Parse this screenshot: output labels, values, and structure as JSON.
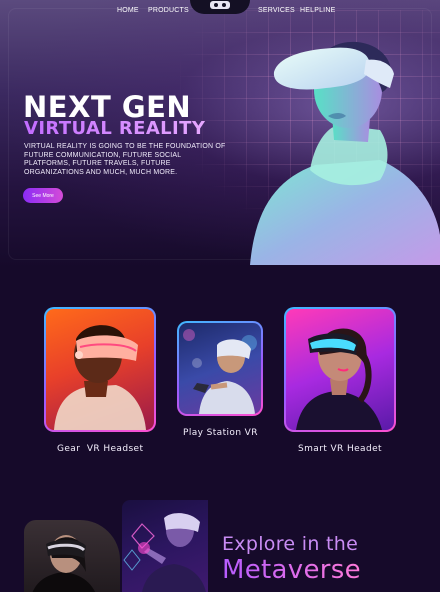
{
  "nav": {
    "items": [
      "HOME",
      "PRODUCTS",
      "SERVICES",
      "HELPLINE"
    ],
    "logo_icon": "vr-headset-icon"
  },
  "hero": {
    "title_line1": "NEXT GEN",
    "title_line2": "VIRTUAL REALITY",
    "description": "VIRTUAL REALITY IS GOING TO BE THE FOUNDATION OF FUTURE COMMUNICATION, FUTURE SOCIAL PLATFORMS, FUTURE TRAVELS, FUTURE ORGANIZATIONS AND MUCH, MUCH MORE.",
    "button_label": "See More"
  },
  "products": [
    {
      "label": "Gear  VR Headset"
    },
    {
      "label": "Play Station VR"
    },
    {
      "label": "Smart VR Headet"
    }
  ],
  "metaverse": {
    "line1": "Explore in the",
    "line2": "Metaverse"
  },
  "colors": {
    "background": "#160a2a",
    "accent_purple": "#b65cff",
    "accent_pink": "#ff4fcf",
    "accent_cyan": "#3fb9ff"
  }
}
